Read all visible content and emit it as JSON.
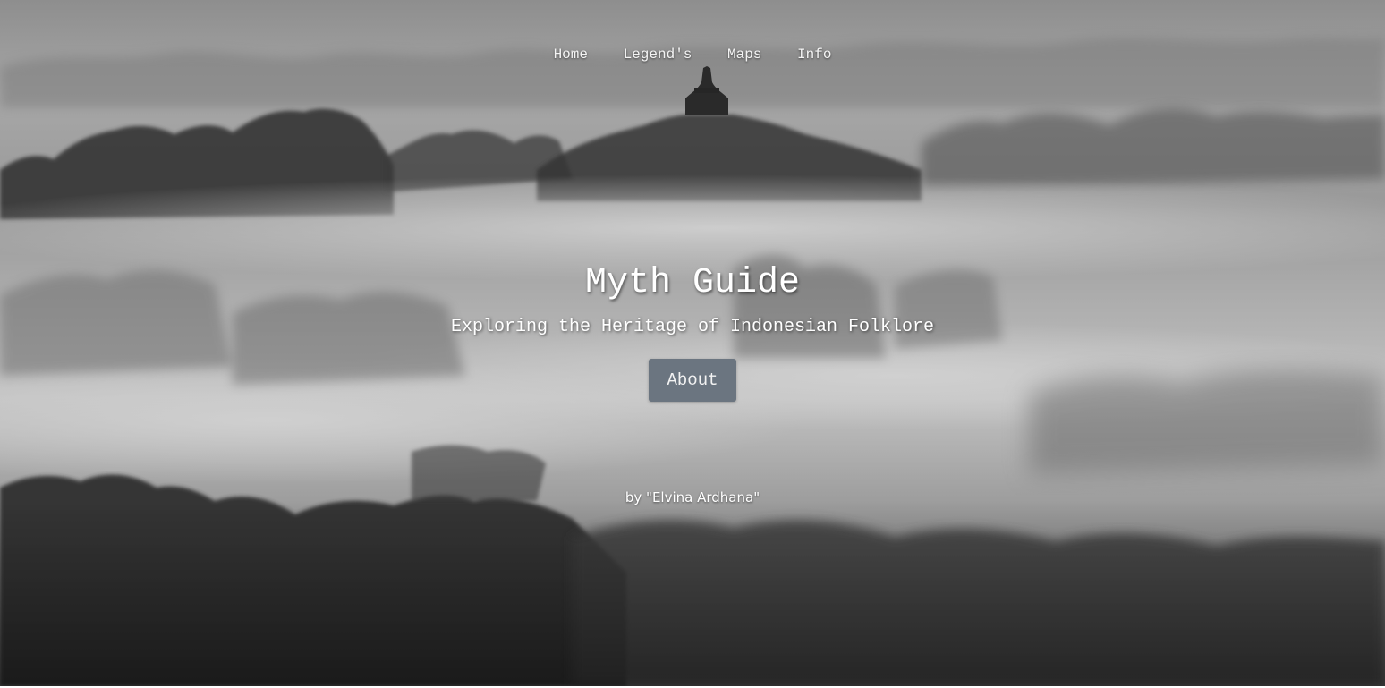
{
  "nav": {
    "items": [
      {
        "label": "Home"
      },
      {
        "label": "Legend's"
      },
      {
        "label": "Maps"
      },
      {
        "label": "Info"
      }
    ]
  },
  "hero": {
    "title": "Myth Guide",
    "subtitle": "Exploring the Heritage of Indonesian Folklore",
    "button_label": "About",
    "author": "by \"Elvina Ardhana\""
  },
  "colors": {
    "button_bg": "#6b7580",
    "text": "#ffffff"
  }
}
